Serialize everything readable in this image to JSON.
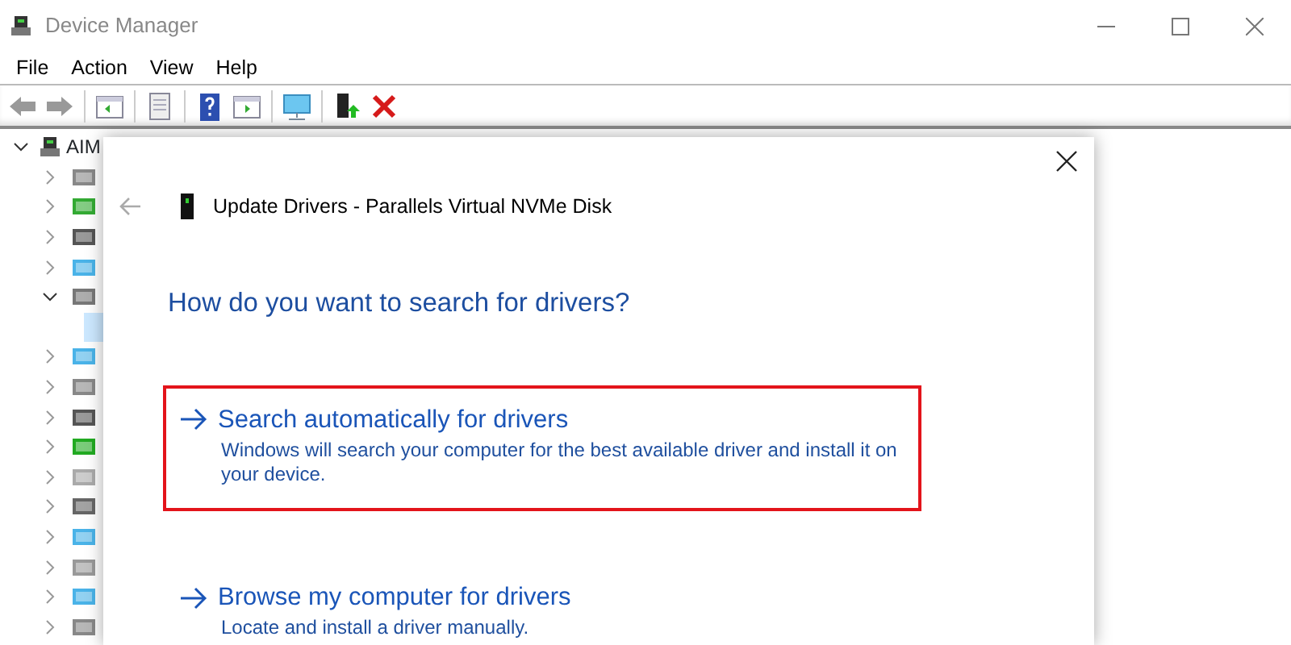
{
  "window": {
    "title": "Device Manager"
  },
  "menu": [
    "File",
    "Action",
    "View",
    "Help"
  ],
  "tree": {
    "label": "AIM",
    "expanded": true,
    "children": [
      {
        "expanded": false
      },
      {
        "expanded": false
      },
      {
        "expanded": false
      },
      {
        "expanded": false
      },
      {
        "expanded": true,
        "children": [
          {
            "selected": true
          }
        ]
      },
      {
        "expanded": false
      },
      {
        "expanded": false
      },
      {
        "expanded": false
      },
      {
        "expanded": false
      },
      {
        "expanded": false
      },
      {
        "expanded": false
      },
      {
        "expanded": false
      },
      {
        "expanded": false
      },
      {
        "expanded": false
      },
      {
        "expanded": false
      }
    ]
  },
  "dialog": {
    "title": "Update Drivers - Parallels Virtual NVMe Disk",
    "heading": "How do you want to search for drivers?",
    "options": [
      {
        "title": "Search automatically for drivers",
        "description": "Windows will search your computer for the best available driver and install it on your device.",
        "highlighted": true
      },
      {
        "title": "Browse my computer for drivers",
        "description": "Locate and install a driver manually.",
        "highlighted": false
      }
    ]
  }
}
